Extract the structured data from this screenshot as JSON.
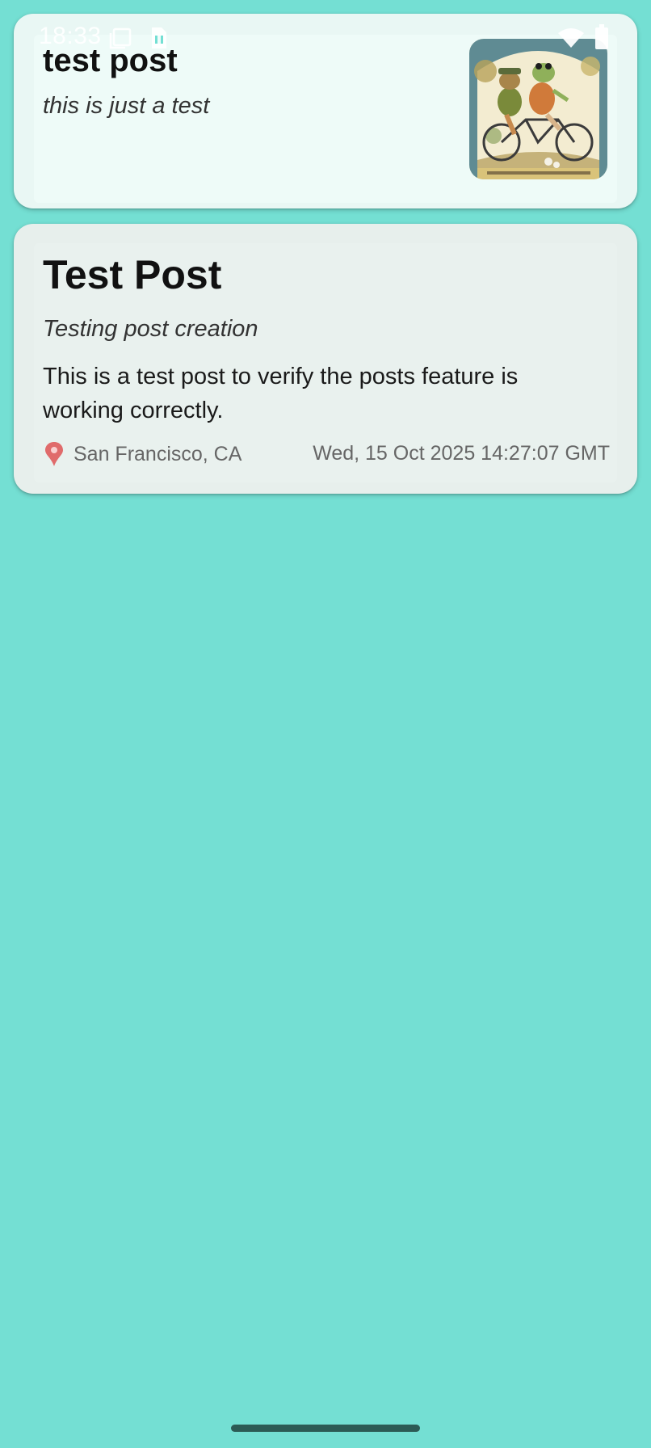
{
  "status_bar": {
    "time": "18:33"
  },
  "posts": [
    {
      "title": "test post",
      "subtitle": "this is just a test",
      "image": "frog-and-toad-on-tandem-bicycle"
    },
    {
      "title": "Test Post",
      "subtitle": "Testing post creation",
      "body": "This is a test post to verify the posts feature is working correctly.",
      "location": "San Francisco, CA",
      "timestamp": "Wed, 15 Oct 2025 14:27:07 GMT"
    }
  ],
  "colors": {
    "background": "#74dfd3",
    "card": "#e9f7f4",
    "home_indicator": "#2c5b55"
  }
}
